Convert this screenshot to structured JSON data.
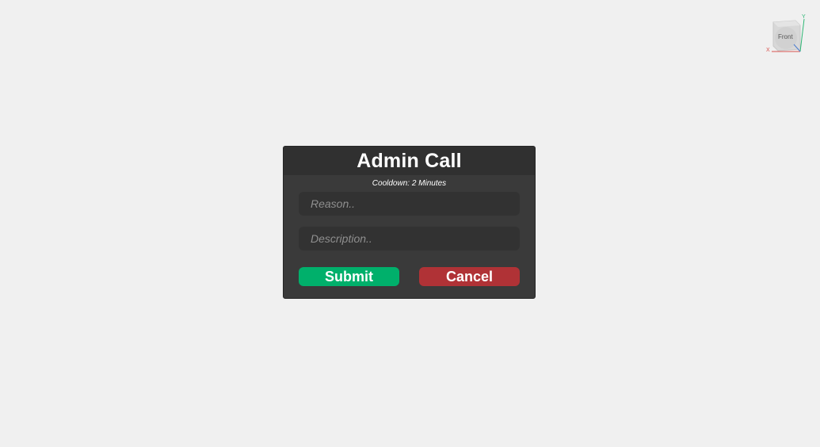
{
  "viewcube": {
    "face_label": "Front",
    "axis_x": "X",
    "axis_y": "Y"
  },
  "dialog": {
    "title": "Admin Call",
    "subtitle": "Cooldown: 2 Minutes",
    "reason_placeholder": "Reason..",
    "reason_value": "",
    "description_placeholder": "Description..",
    "description_value": "",
    "submit_label": "Submit",
    "cancel_label": "Cancel"
  },
  "colors": {
    "background": "#f0f0f0",
    "dialog_body": "#3a3a3a",
    "dialog_header": "#303030",
    "field": "#323232",
    "submit": "#00b06b",
    "cancel": "#b03236"
  },
  "icons": {
    "viewcube": "view-cube-icon"
  }
}
